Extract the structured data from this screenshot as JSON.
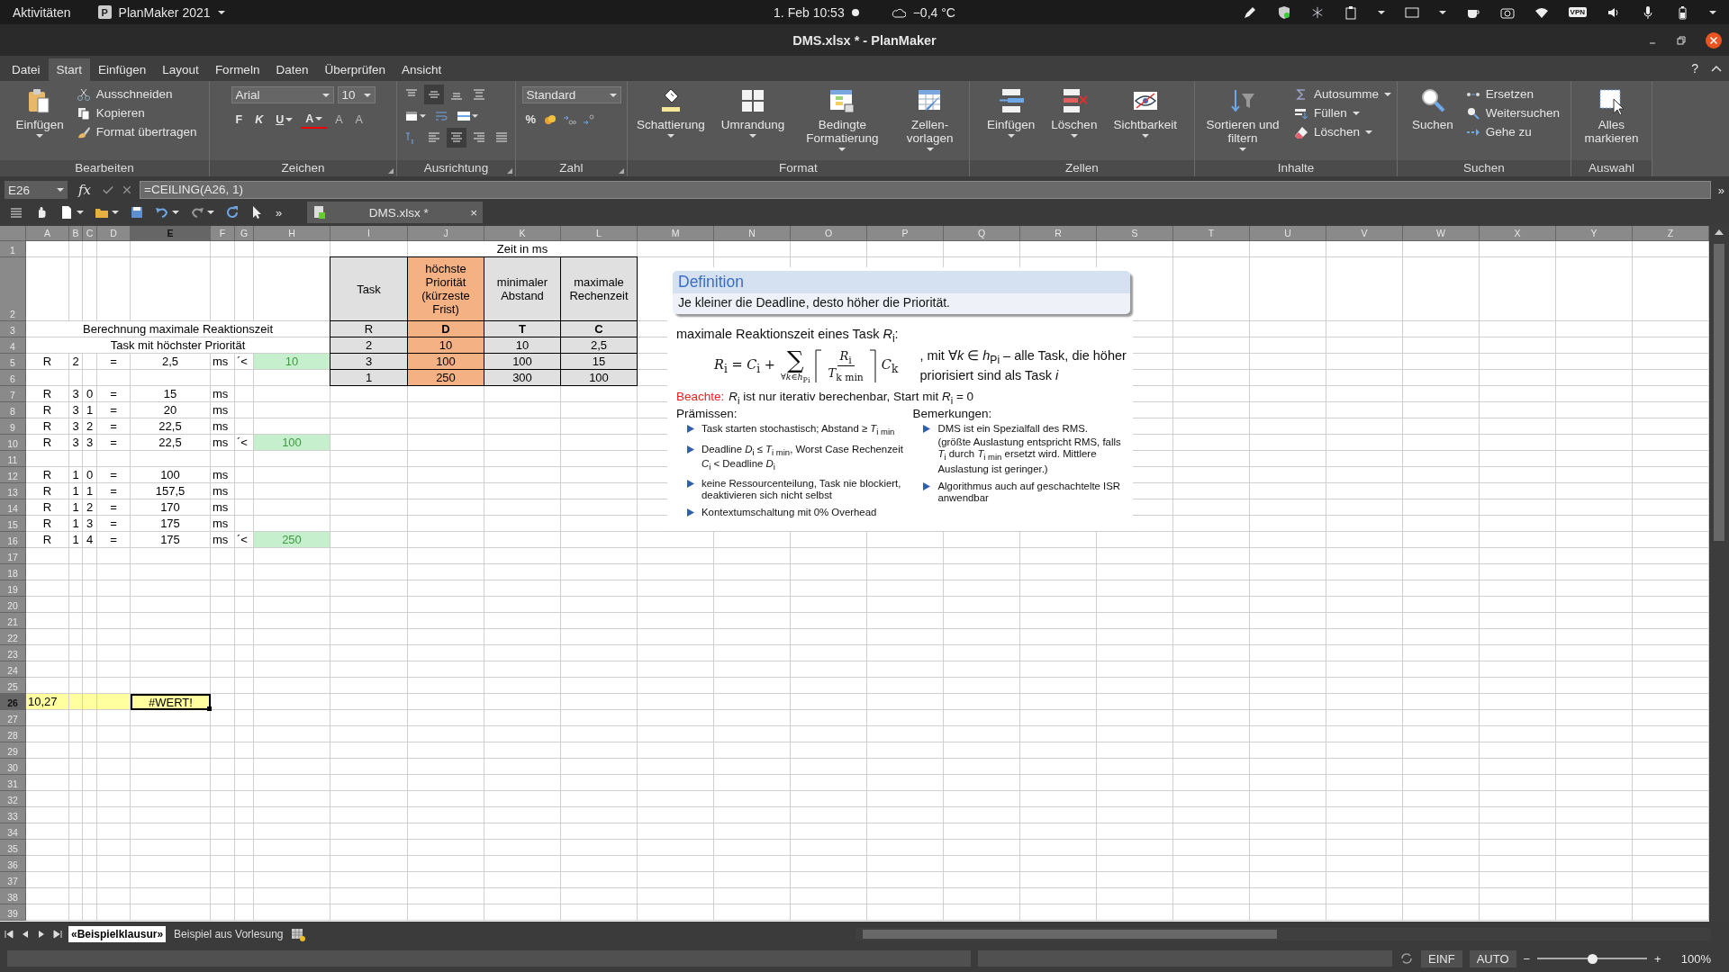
{
  "topbar": {
    "activities": "Aktivitäten",
    "app_icon": "P",
    "app": "PlanMaker 2021",
    "clock": "1. Feb  10:53",
    "weather": "−0,4 °C",
    "vpn": "VPN"
  },
  "window": {
    "title": "DMS.xlsx * - PlanMaker"
  },
  "menu": [
    {
      "label": "Datei",
      "selected": false
    },
    {
      "label": "Start",
      "selected": true
    },
    {
      "label": "Einfügen",
      "selected": false
    },
    {
      "label": "Layout",
      "selected": false
    },
    {
      "label": "Formeln",
      "selected": false
    },
    {
      "label": "Daten",
      "selected": false
    },
    {
      "label": "Überprüfen",
      "selected": false
    },
    {
      "label": "Ansicht",
      "selected": false
    }
  ],
  "help": "?",
  "ribbon": {
    "groups": [
      {
        "kind": "buttons",
        "label": "Bearbeiten",
        "launcher": false,
        "items": [
          {
            "kind": "large",
            "label": "Einfügen",
            "dropdown": true
          },
          {
            "kind": "small",
            "label": "Ausschneiden",
            "dropdown": false
          },
          {
            "kind": "small",
            "label": "Kopieren",
            "dropdown": false
          },
          {
            "kind": "small",
            "label": "Format übertragen",
            "dropdown": false
          }
        ]
      },
      {
        "kind": "font",
        "label": "Zeichen",
        "launcher": true,
        "font": "Arial",
        "size": "10",
        "buttons": [
          {
            "label": "F",
            "dropdown": false
          },
          {
            "label": "K",
            "dropdown": false
          },
          {
            "label": "U",
            "dropdown": true
          },
          {
            "label": "A",
            "dropdown": true
          },
          {
            "label": "A",
            "dropdown": false
          },
          {
            "label": "A",
            "dropdown": false
          }
        ]
      },
      {
        "kind": "align",
        "label": "Ausrichtung",
        "launcher": true,
        "buttons": [
          {
            "selected": false
          },
          {
            "selected": true
          },
          {
            "selected": false
          },
          {
            "selected": false
          },
          {
            "selected": false
          },
          {
            "selected": false
          },
          {
            "selected": false
          },
          {
            "selected": false
          },
          {
            "selected": false
          },
          {
            "selected": true
          },
          {
            "selected": false
          },
          {
            "selected": false
          }
        ]
      },
      {
        "kind": "number",
        "label": "Zahl",
        "launcher": true,
        "format": "Standard",
        "percent": "%"
      },
      {
        "kind": "buttons",
        "label": "Format",
        "launcher": false,
        "items": [
          {
            "kind": "large",
            "label": "Schattierung",
            "dropdown": true
          },
          {
            "kind": "large",
            "label": "Umrandung",
            "dropdown": true
          },
          {
            "kind": "large",
            "label": "Bedingte Formatierung",
            "dropdown": true
          },
          {
            "kind": "large",
            "label": "Zellen-vorlagen",
            "dropdown": true
          }
        ]
      },
      {
        "kind": "buttons",
        "label": "Zellen",
        "launcher": false,
        "items": [
          {
            "kind": "large",
            "label": "Einfügen",
            "dropdown": true
          },
          {
            "kind": "large",
            "label": "Löschen",
            "dropdown": true
          },
          {
            "kind": "large",
            "label": "Sichtbarkeit",
            "dropdown": true
          }
        ]
      },
      {
        "kind": "buttons",
        "label": "Inhalte",
        "launcher": false,
        "items": [
          {
            "kind": "large",
            "label": "Sortieren und filtern",
            "dropdown": true
          },
          {
            "kind": "small",
            "label": "Autosumme",
            "dropdown": true
          },
          {
            "kind": "small",
            "label": "Füllen",
            "dropdown": true
          },
          {
            "kind": "small",
            "label": "Löschen",
            "dropdown": true
          }
        ]
      },
      {
        "kind": "buttons",
        "label": "Suchen",
        "launcher": false,
        "items": [
          {
            "kind": "large",
            "label": "Suchen",
            "dropdown": false
          },
          {
            "kind": "small",
            "label": "Ersetzen",
            "dropdown": false
          },
          {
            "kind": "small",
            "label": "Weitersuchen",
            "dropdown": false
          },
          {
            "kind": "small",
            "label": "Gehe zu",
            "dropdown": false
          }
        ]
      },
      {
        "kind": "buttons",
        "label": "Auswahl",
        "launcher": false,
        "items": [
          {
            "kind": "large",
            "label": "Alles markieren",
            "dropdown": false
          }
        ]
      }
    ]
  },
  "formula_bar": {
    "cell": "E26",
    "fx": "fx",
    "formula": "=CEILING(A26, 1)",
    "expand": "»"
  },
  "toolbar": {
    "more": "»",
    "document_tab": {
      "label": "DMS.xlsx *",
      "close": "×"
    }
  },
  "sheet": {
    "columns": [
      {
        "label": "A",
        "selected": false
      },
      {
        "label": "B",
        "selected": false
      },
      {
        "label": "C",
        "selected": false
      },
      {
        "label": "D",
        "selected": false
      },
      {
        "label": "E",
        "selected": true
      },
      {
        "label": "F",
        "selected": false
      },
      {
        "label": "G",
        "selected": false
      },
      {
        "label": "H",
        "selected": false
      },
      {
        "label": "I",
        "selected": false
      },
      {
        "label": "J",
        "selected": false
      },
      {
        "label": "K",
        "selected": false
      },
      {
        "label": "L",
        "selected": false
      },
      {
        "label": "M",
        "selected": false
      },
      {
        "label": "N",
        "selected": false
      },
      {
        "label": "O",
        "selected": false
      },
      {
        "label": "P",
        "selected": false
      },
      {
        "label": "Q",
        "selected": false
      },
      {
        "label": "R",
        "selected": false
      },
      {
        "label": "S",
        "selected": false
      },
      {
        "label": "T",
        "selected": false
      },
      {
        "label": "U",
        "selected": false
      },
      {
        "label": "V",
        "selected": false
      },
      {
        "label": "W",
        "selected": false
      },
      {
        "label": "X",
        "selected": false
      },
      {
        "label": "Y",
        "selected": false
      },
      {
        "label": "Z",
        "selected": false
      }
    ],
    "rows": [
      {
        "label": "1",
        "selected": false,
        "cells": {
          "J-L": {
            "text": "Zeit in ms"
          }
        }
      },
      {
        "label": "2",
        "selected": false,
        "cells": {
          "I": {
            "text": "Task",
            "color": "#e0e0e0",
            "boxed": true
          },
          "J": {
            "text": "höchste Priorität (kürzeste Frist)",
            "color": "#f4b183",
            "boxed": true
          },
          "K": {
            "text": "minimaler Abstand",
            "color": "#e0e0e0",
            "boxed": true
          },
          "L": {
            "text": "maximale Rechenzeit",
            "color": "#e0e0e0",
            "boxed": true
          }
        }
      },
      {
        "label": "3",
        "selected": false,
        "cells": {
          "A-H": {
            "text": "Berechnung maximale Reaktionszeit"
          },
          "I": {
            "text": "R",
            "color": "#e0e0e0",
            "boxed": true
          },
          "J": {
            "text": "D",
            "bold": true,
            "color": "#f4b183",
            "boxed": true
          },
          "K": {
            "text": "T",
            "bold": true,
            "color": "#e0e0e0",
            "boxed": true
          },
          "L": {
            "text": "C",
            "bold": true,
            "color": "#e0e0e0",
            "boxed": true
          }
        }
      },
      {
        "label": "4",
        "selected": false,
        "cells": {
          "A-H": {
            "text": "Task mit höchster Priorität"
          },
          "I": {
            "text": "2",
            "color": "#e0e0e0",
            "boxed": true
          },
          "J": {
            "text": "10",
            "color": "#f4b183",
            "boxed": true
          },
          "K": {
            "text": "10",
            "color": "#e0e0e0",
            "boxed": true
          },
          "L": {
            "text": "2,5",
            "color": "#e0e0e0",
            "boxed": true
          }
        }
      },
      {
        "label": "5",
        "selected": false,
        "cells": {
          "A": {
            "text": "R"
          },
          "B": {
            "text": "2"
          },
          "D": {
            "text": "="
          },
          "E": {
            "text": "2,5"
          },
          "F": {
            "text": "ms"
          },
          "G": {
            "text": "´<"
          },
          "H": {
            "text": "10",
            "color": "#c6efce",
            "kind": "result"
          },
          "I": {
            "text": "3",
            "color": "#e0e0e0",
            "boxed": true
          },
          "J": {
            "text": "100",
            "color": "#f4b183",
            "boxed": true
          },
          "K": {
            "text": "100",
            "color": "#e0e0e0",
            "boxed": true
          },
          "L": {
            "text": "15",
            "color": "#e0e0e0",
            "boxed": true
          }
        }
      },
      {
        "label": "6",
        "selected": false,
        "cells": {
          "I": {
            "text": "1",
            "color": "#e0e0e0",
            "boxed": true
          },
          "J": {
            "text": "250",
            "color": "#f4b183",
            "boxed": true
          },
          "K": {
            "text": "300",
            "color": "#e0e0e0",
            "boxed": true
          },
          "L": {
            "text": "100",
            "color": "#e0e0e0",
            "boxed": true
          }
        }
      },
      {
        "label": "7",
        "selected": false,
        "cells": {
          "A": {
            "text": "R"
          },
          "B": {
            "text": "3"
          },
          "C": {
            "text": "0"
          },
          "D": {
            "text": "="
          },
          "E": {
            "text": "15"
          },
          "F": {
            "text": "ms"
          }
        }
      },
      {
        "label": "8",
        "selected": false,
        "cells": {
          "A": {
            "text": "R"
          },
          "B": {
            "text": "3"
          },
          "C": {
            "text": "1"
          },
          "D": {
            "text": "="
          },
          "E": {
            "text": "20"
          },
          "F": {
            "text": "ms"
          }
        }
      },
      {
        "label": "9",
        "selected": false,
        "cells": {
          "A": {
            "text": "R"
          },
          "B": {
            "text": "3"
          },
          "C": {
            "text": "2"
          },
          "D": {
            "text": "="
          },
          "E": {
            "text": "22,5"
          },
          "F": {
            "text": "ms"
          }
        }
      },
      {
        "label": "10",
        "selected": false,
        "cells": {
          "A": {
            "text": "R"
          },
          "B": {
            "text": "3"
          },
          "C": {
            "text": "3"
          },
          "D": {
            "text": "="
          },
          "E": {
            "text": "22,5"
          },
          "F": {
            "text": "ms"
          },
          "G": {
            "text": "´<"
          },
          "H": {
            "text": "100",
            "color": "#c6efce",
            "kind": "result"
          }
        }
      },
      {
        "label": "11",
        "selected": false
      },
      {
        "label": "12",
        "selected": false,
        "cells": {
          "A": {
            "text": "R"
          },
          "B": {
            "text": "1"
          },
          "C": {
            "text": "0"
          },
          "D": {
            "text": "="
          },
          "E": {
            "text": "100"
          },
          "F": {
            "text": "ms"
          }
        }
      },
      {
        "label": "13",
        "selected": false,
        "cells": {
          "A": {
            "text": "R"
          },
          "B": {
            "text": "1"
          },
          "C": {
            "text": "1"
          },
          "D": {
            "text": "="
          },
          "E": {
            "text": "157,5"
          },
          "F": {
            "text": "ms"
          }
        }
      },
      {
        "label": "14",
        "selected": false,
        "cells": {
          "A": {
            "text": "R"
          },
          "B": {
            "text": "1"
          },
          "C": {
            "text": "2"
          },
          "D": {
            "text": "="
          },
          "E": {
            "text": "170"
          },
          "F": {
            "text": "ms"
          }
        }
      },
      {
        "label": "15",
        "selected": false,
        "cells": {
          "A": {
            "text": "R"
          },
          "B": {
            "text": "1"
          },
          "C": {
            "text": "3"
          },
          "D": {
            "text": "="
          },
          "E": {
            "text": "175"
          },
          "F": {
            "text": "ms"
          }
        }
      },
      {
        "label": "16",
        "selected": false,
        "cells": {
          "A": {
            "text": "R"
          },
          "B": {
            "text": "1"
          },
          "C": {
            "text": "4"
          },
          "D": {
            "text": "="
          },
          "E": {
            "text": "175"
          },
          "F": {
            "text": "ms"
          },
          "G": {
            "text": "´<"
          },
          "H": {
            "text": "250",
            "color": "#c6efce",
            "kind": "result"
          }
        }
      },
      {
        "label": "17",
        "selected": false
      },
      {
        "label": "18",
        "selected": false
      },
      {
        "label": "19",
        "selected": false
      },
      {
        "label": "20",
        "selected": false
      },
      {
        "label": "21",
        "selected": false
      },
      {
        "label": "22",
        "selected": false
      },
      {
        "label": "23",
        "selected": false
      },
      {
        "label": "24",
        "selected": false
      },
      {
        "label": "25",
        "selected": false
      },
      {
        "label": "26",
        "selected": true,
        "cells": {
          "A": {
            "text": "10,27",
            "color": "#ffff9f"
          },
          "B": {
            "color": "#ffff9f"
          },
          "C": {
            "color": "#ffff9f"
          },
          "D": {
            "color": "#ffff9f"
          },
          "E": {
            "text": "#WERT!",
            "color": "#ffff9f",
            "active": true
          }
        }
      },
      {
        "label": "27",
        "selected": false
      },
      {
        "label": "28",
        "selected": false
      },
      {
        "label": "29",
        "selected": false
      },
      {
        "label": "30",
        "selected": false
      },
      {
        "label": "31",
        "selected": false
      },
      {
        "label": "32",
        "selected": false
      },
      {
        "label": "33",
        "selected": false
      },
      {
        "label": "34",
        "selected": false
      },
      {
        "label": "35",
        "selected": false
      },
      {
        "label": "36",
        "selected": false
      },
      {
        "label": "37",
        "selected": false
      },
      {
        "label": "38",
        "selected": false
      },
      {
        "label": "39",
        "selected": false
      }
    ]
  },
  "slide": {
    "definition": {
      "title": "Definition",
      "text": "Je kleiner die Deadline, desto höher die Priorität."
    },
    "heading": "maximale Reaktionszeit eines Task *R*$_{i}$:",
    "formula": {
      "lhs": "*R*$_{i}$ = *C*$_{i}$ +",
      "sum": "∑",
      "index": "∀*k*∈*h*$_{Pi}$",
      "numerator": "*R*$_{i}$",
      "denominator": "*T*$_{k min}$",
      "factor": "*C*$_{k}$"
    },
    "formula_note": ", mit ∀*k* ∈ *h*$_{Pi}$ – alle Task, die höher priorisiert sind als Task *i*",
    "note_label": "Beachte:",
    "note": "*R*$_{i}$ ist nur iterativ berechenbar, Start mit *R*$_{i}$ = 0",
    "columns": [
      {
        "heading": "Prämissen:",
        "items": [
          {
            "text": "Task starten stochastisch; Abstand ≥ *T*$_{i min}$"
          },
          {
            "text": "Deadline *D*$_{i}$ ≤ *T*$_{i min}$, Worst Case Rechenzeit *C*$_{i}$ < Deadline *D*$_{i}$"
          },
          {
            "text": "keine Ressourcenteilung, Task nie blockiert, deaktivieren sich nicht selbst"
          },
          {
            "text": "Kontextumschaltung mit 0% Overhead"
          }
        ]
      },
      {
        "heading": "Bemerkungen:",
        "items": [
          {
            "text": "DMS ist ein Spezialfall des RMS.",
            "detail": "(größte Auslastung entspricht RMS, falls *T*$_{i}$ durch *T*$_{i min}$ ersetzt wird. Mittlere Auslastung ist geringer.)"
          },
          {
            "text": "Algorithmus auch auf geschachtelte ISR anwendbar"
          }
        ]
      }
    ]
  },
  "sheet_tabs": [
    {
      "label": "«Beispielklausur»",
      "selected": true
    },
    {
      "label": "Beispiel aus Vorlesung",
      "selected": false
    }
  ],
  "status_bar": {
    "mode": "EINF",
    "calc": "AUTO",
    "zoom_minus": "−",
    "zoom_plus": "+",
    "zoom": {
      "level": 0.5
    },
    "zoom_label": "100%"
  }
}
